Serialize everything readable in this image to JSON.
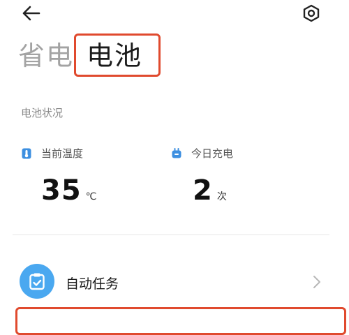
{
  "header": {
    "back_icon": "arrow-left-icon",
    "settings_icon": "hexagon-gear-icon"
  },
  "tabs": [
    {
      "label": "省电",
      "active": false
    },
    {
      "label": "电池",
      "active": true
    }
  ],
  "battery_status": {
    "section_label": "电池状况",
    "temperature": {
      "label": "当前温度",
      "value": "35",
      "unit": "℃",
      "icon": "thermometer-icon"
    },
    "charge_count": {
      "label": "今日充电",
      "value": "2",
      "unit": "次",
      "icon": "plug-icon"
    }
  },
  "rows": [
    {
      "label": "自动任务",
      "icon": "clipboard-check-icon"
    }
  ],
  "colors": {
    "accent_blue": "#4aa8f0",
    "highlight_red": "#e04a2e",
    "inactive_tab": "#a3a3a3"
  }
}
